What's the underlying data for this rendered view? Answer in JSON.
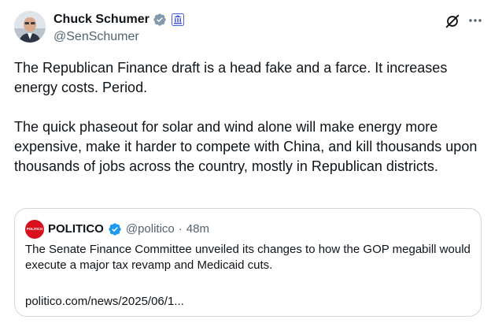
{
  "author": {
    "display_name": "Chuck Schumer",
    "handle": "@SenSchumer"
  },
  "tweet": {
    "paragraphs": [
      "The Republican Finance draft is a head fake and a farce. It increases energy costs. Period.",
      "The quick phaseout for solar and wind alone will make energy more expensive, make it harder to compete with China, and kill thousands upon thousands of jobs across the country, mostly in Republican districts."
    ]
  },
  "quote": {
    "avatar_text": "POLITICO",
    "display_name": "POLITICO",
    "handle": "@politico",
    "separator": "·",
    "time": "48m",
    "text": "The Senate Finance Committee unveiled its changes to how the GOP megabill would execute a major tax revamp and Medicaid cuts.",
    "link": "politico.com/news/2025/06/1..."
  },
  "icons": {
    "verified": "verified-badge-icon",
    "government": "government-badge-icon",
    "grok": "grok-icon",
    "more": "more-options-icon"
  },
  "colors": {
    "verified_blue": "#1d9bf0",
    "gov_badge": "#829aab",
    "text_primary": "#0f1419",
    "text_secondary": "#536471",
    "border": "#cfd9de",
    "politico_red": "#d7101b"
  }
}
